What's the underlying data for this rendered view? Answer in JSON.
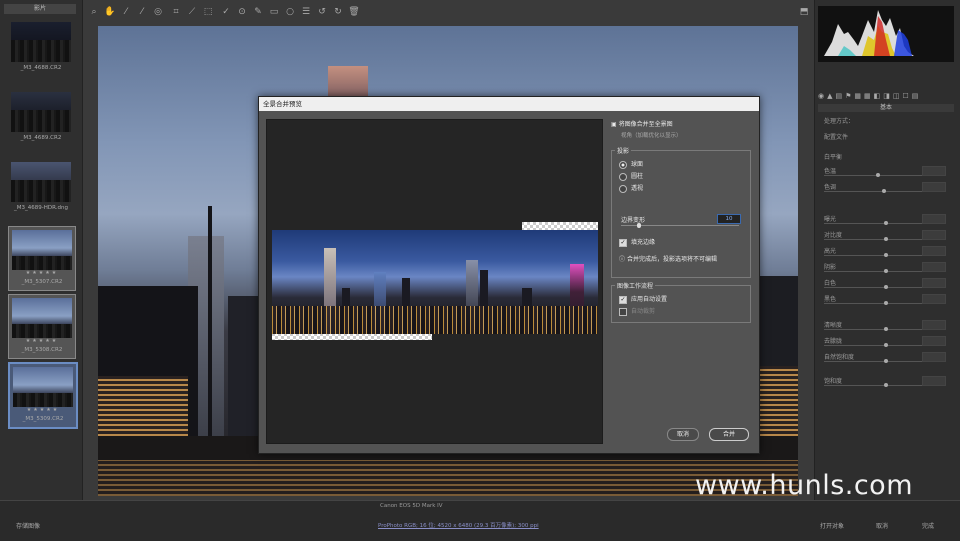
{
  "filmstrip": {
    "header": "影片",
    "items": [
      {
        "caption": "_M3_4688.CR2",
        "stars": ""
      },
      {
        "caption": "_M3_4689.CR2",
        "stars": ""
      },
      {
        "caption": "_M3_4689-HDR.dng",
        "stars": ""
      },
      {
        "caption": "_M3_5307.CR2",
        "stars": "★★★★★"
      },
      {
        "caption": "_M3_5308.CR2",
        "stars": "★★★★★"
      },
      {
        "caption": "_M3_5309.CR2",
        "stars": "★★★★★"
      }
    ]
  },
  "toolbar": {
    "tools": [
      "zoom-icon",
      "hand-icon",
      "white-balance-icon",
      "color-sampler-icon",
      "target-adjust-icon",
      "crop-icon",
      "straighten-icon",
      "transform-icon",
      "spot-removal-icon",
      "red-eye-icon",
      "adjustment-brush-icon",
      "graduated-filter-icon",
      "radial-filter-icon",
      "preferences-icon",
      "rotate-left-icon",
      "rotate-right-icon",
      "trash-icon"
    ]
  },
  "dialog": {
    "title": "全景合并预览",
    "option_heading": "将图像合并至全景图",
    "option_sub": "视角（加载优化以显示）",
    "projection_label": "投影",
    "projections": [
      "球面",
      "圆柱",
      "透视"
    ],
    "projection_selected": 0,
    "boundary_warp_label": "边界变形",
    "boundary_warp_value": "10",
    "fill_edges_label": "填充边缘",
    "fill_edges_checked": true,
    "info_text": "合并完成后，投影选项将不可编辑",
    "workflow_label": "图像工作流程",
    "auto_settings_label": "应用自动设置",
    "auto_settings_checked": true,
    "auto_crop_label": "自动裁剪",
    "auto_crop_checked": false,
    "cancel_label": "取消",
    "merge_label": "合并"
  },
  "right_panel": {
    "section": "基本",
    "rows": [
      "处理方式：",
      "配置文件",
      "白平衡",
      "色温",
      "色调",
      "曝光",
      "对比度",
      "高光",
      "阴影",
      "白色",
      "黑色",
      "清晰度",
      "去朦胧",
      "自然饱和度",
      "饱和度"
    ]
  },
  "status": {
    "left": "存储图像",
    "middle": "Canon EOS 5D Mark IV",
    "link": "ProPhoto RGB; 16 位; 4520 x 6480 (29.3 百万像素); 300 ppi",
    "right_open": "打开对象",
    "right_cancel": "取消",
    "right_done": "完成"
  },
  "watermark": "www.hunls.com",
  "colors": {
    "panel": "#2f2f2f",
    "dialog": "#535353",
    "link": "#8a8fc8"
  }
}
